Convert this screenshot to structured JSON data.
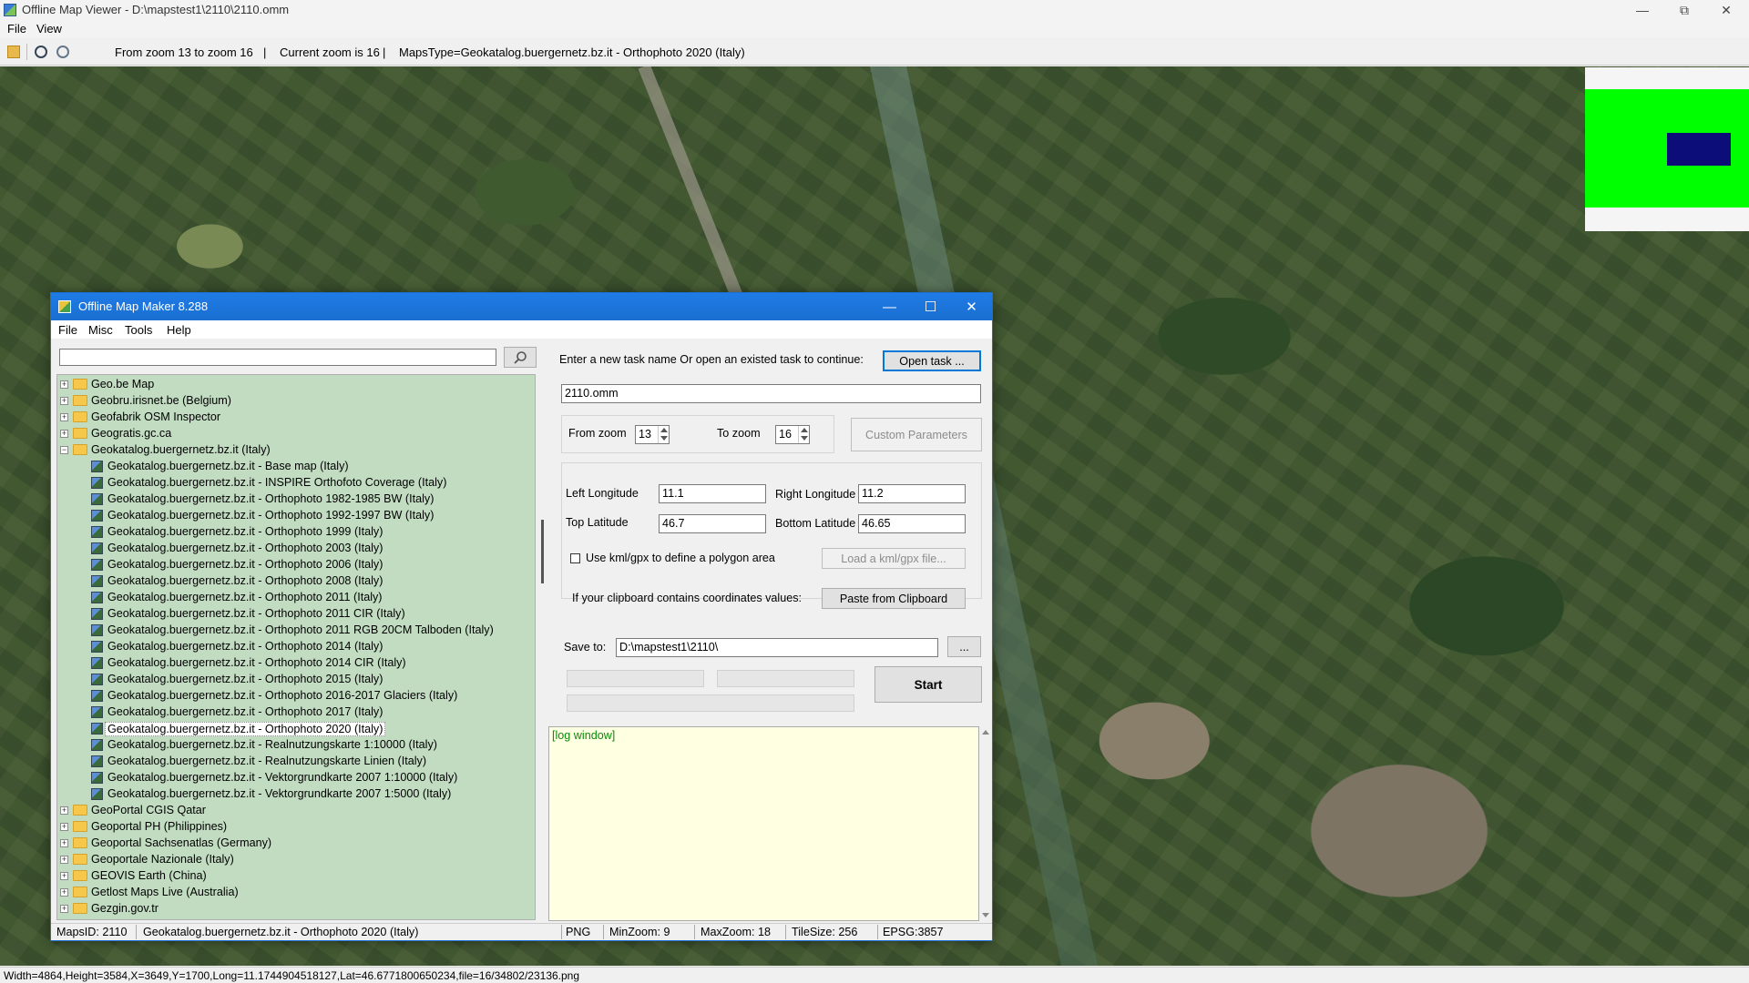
{
  "viewer": {
    "title": "Offline Map Viewer - D:\\mapstest1\\2110\\2110.omm",
    "menu": [
      "File",
      "View"
    ],
    "toolbar": {
      "zoom_range": "From zoom 13 to zoom 16",
      "current_zoom": "Current zoom is 16",
      "maps_type": "MapsType=Geokatalog.buergernetz.bz.it - Orthophoto 2020 (Italy)",
      "separator": "|"
    },
    "status": "Width=4864,Height=3584,X=3649,Y=1700,Long=11.1744904518127,Lat=46.6771800650234,file=16/34802/23136.png"
  },
  "colors": {
    "titlebar_blue": "#1a6fd0",
    "tree_bg": "#c2dcc2",
    "minimap_green": "#00ff00",
    "minimap_box": "#0d0d7a",
    "log_bg": "#ffffe1",
    "log_text": "#0a8a0a"
  },
  "maker": {
    "title": "Offline Map Maker 8.288",
    "menu": [
      "File",
      "Misc",
      "Tools",
      "Help"
    ],
    "search": {
      "value": "",
      "icon": "magnifier-icon"
    },
    "tree": [
      {
        "label": "Geo.be Map",
        "type": "folder",
        "expanded": false
      },
      {
        "label": "Geobru.irisnet.be (Belgium)",
        "type": "folder",
        "expanded": false
      },
      {
        "label": "Geofabrik OSM Inspector",
        "type": "folder",
        "expanded": false
      },
      {
        "label": "Geogratis.gc.ca",
        "type": "folder",
        "expanded": false
      },
      {
        "label": "Geokatalog.buergernetz.bz.it (Italy)",
        "type": "folder",
        "expanded": true
      },
      {
        "label": "Geokatalog.buergernetz.bz.it - Base map (Italy)",
        "type": "map"
      },
      {
        "label": "Geokatalog.buergernetz.bz.it - INSPIRE Orthofoto Coverage (Italy)",
        "type": "map"
      },
      {
        "label": "Geokatalog.buergernetz.bz.it - Orthophoto 1982-1985 BW (Italy)",
        "type": "map"
      },
      {
        "label": "Geokatalog.buergernetz.bz.it - Orthophoto 1992-1997 BW (Italy)",
        "type": "map"
      },
      {
        "label": "Geokatalog.buergernetz.bz.it - Orthophoto 1999 (Italy)",
        "type": "map"
      },
      {
        "label": "Geokatalog.buergernetz.bz.it - Orthophoto 2003 (Italy)",
        "type": "map"
      },
      {
        "label": "Geokatalog.buergernetz.bz.it - Orthophoto 2006 (Italy)",
        "type": "map"
      },
      {
        "label": "Geokatalog.buergernetz.bz.it - Orthophoto 2008 (Italy)",
        "type": "map"
      },
      {
        "label": "Geokatalog.buergernetz.bz.it - Orthophoto 2011 (Italy)",
        "type": "map"
      },
      {
        "label": "Geokatalog.buergernetz.bz.it - Orthophoto 2011 CIR (Italy)",
        "type": "map"
      },
      {
        "label": "Geokatalog.buergernetz.bz.it - Orthophoto 2011 RGB 20CM Talboden (Italy)",
        "type": "map"
      },
      {
        "label": "Geokatalog.buergernetz.bz.it - Orthophoto 2014 (Italy)",
        "type": "map"
      },
      {
        "label": "Geokatalog.buergernetz.bz.it - Orthophoto 2014 CIR (Italy)",
        "type": "map"
      },
      {
        "label": "Geokatalog.buergernetz.bz.it - Orthophoto 2015 (Italy)",
        "type": "map"
      },
      {
        "label": "Geokatalog.buergernetz.bz.it - Orthophoto 2016-2017 Glaciers (Italy)",
        "type": "map"
      },
      {
        "label": "Geokatalog.buergernetz.bz.it - Orthophoto 2017 (Italy)",
        "type": "map"
      },
      {
        "label": "Geokatalog.buergernetz.bz.it - Orthophoto 2020 (Italy)",
        "type": "map",
        "selected": true
      },
      {
        "label": "Geokatalog.buergernetz.bz.it - Realnutzungskarte 1:10000 (Italy)",
        "type": "map"
      },
      {
        "label": "Geokatalog.buergernetz.bz.it - Realnutzungskarte Linien (Italy)",
        "type": "map"
      },
      {
        "label": "Geokatalog.buergernetz.bz.it - Vektorgrundkarte 2007 1:10000 (Italy)",
        "type": "map"
      },
      {
        "label": "Geokatalog.buergernetz.bz.it - Vektorgrundkarte 2007 1:5000 (Italy)",
        "type": "map"
      },
      {
        "label": "GeoPortal CGIS Qatar",
        "type": "folder",
        "expanded": false
      },
      {
        "label": "Geoportal PH (Philippines)",
        "type": "folder",
        "expanded": false
      },
      {
        "label": "Geoportal Sachsenatlas (Germany)",
        "type": "folder",
        "expanded": false
      },
      {
        "label": "Geoportale Nazionale (Italy)",
        "type": "folder",
        "expanded": false
      },
      {
        "label": "GEOVIS Earth (China)",
        "type": "folder",
        "expanded": false
      },
      {
        "label": "Getlost Maps Live (Australia)",
        "type": "folder",
        "expanded": false
      },
      {
        "label": "Gezgin.gov.tr",
        "type": "folder",
        "expanded": false
      }
    ],
    "task": {
      "prompt": "Enter a new task name Or open an existed task to continue:",
      "open_button": "Open task ...",
      "name_value": "2110.omm"
    },
    "zoom": {
      "from_label": "From zoom",
      "from_value": "13",
      "to_label": "To zoom",
      "to_value": "16",
      "custom_button": "Custom Parameters"
    },
    "coords": {
      "left_lon_label": "Left Longitude",
      "left_lon_value": "11.1",
      "right_lon_label": "Right Longitude",
      "right_lon_value": "11.2",
      "top_lat_label": "Top Latitude",
      "top_lat_value": "46.7",
      "bottom_lat_label": "Bottom Latitude",
      "bottom_lat_value": "46.65"
    },
    "kml": {
      "checkbox_label": "Use kml/gpx to define a polygon area",
      "checked": false,
      "load_button": "Load a kml/gpx file..."
    },
    "clipboard": {
      "label": "If your clipboard contains coordinates values:",
      "button": "Paste from Clipboard"
    },
    "save": {
      "label": "Save to:",
      "value": "D:\\mapstest1\\2110\\",
      "browse": "..."
    },
    "start_button": "Start",
    "log": "[log window]",
    "status": {
      "maps_id": "MapsID: 2110",
      "name": "Geokatalog.buergernetz.bz.it - Orthophoto 2020 (Italy)",
      "format": "PNG",
      "min_zoom": "MinZoom: 9",
      "max_zoom": "MaxZoom: 18",
      "tile_size": "TileSize: 256",
      "epsg": "EPSG:3857"
    }
  }
}
